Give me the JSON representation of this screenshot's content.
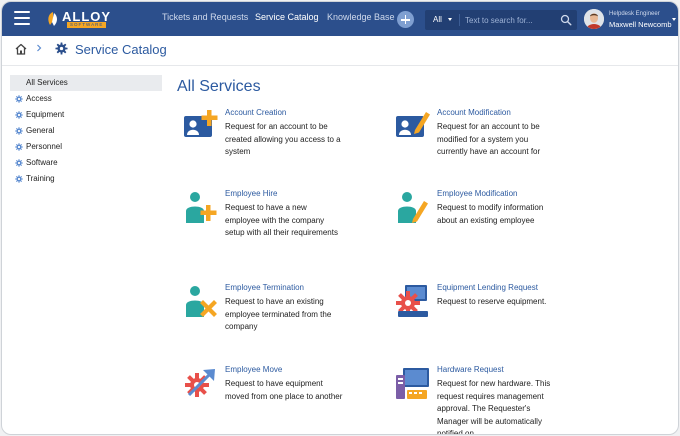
{
  "header": {
    "logo": {
      "brand": "ALLOY",
      "sub": "SOFTWARE"
    },
    "nav": [
      {
        "label": "Tickets and Requests",
        "active": false
      },
      {
        "label": "Service Catalog",
        "active": true
      },
      {
        "label": "Knowledge Base",
        "active": false
      }
    ],
    "add_icon": "plus-icon",
    "search": {
      "scope": "All",
      "placeholder": "Text to search for..."
    },
    "user": {
      "role": "Helpdesk Engineer",
      "name": "Maxwell Newcomb"
    },
    "colors": {
      "bar": "#2c4f8c",
      "search_bg": "#223f73",
      "accent": "#f5a623"
    }
  },
  "breadcrumb": {
    "home_icon": "home-icon",
    "current": "Service Catalog"
  },
  "sidebar": {
    "items": [
      {
        "label": "All Services",
        "active": true
      },
      {
        "label": "Access"
      },
      {
        "label": "Equipment"
      },
      {
        "label": "General"
      },
      {
        "label": "Personnel"
      },
      {
        "label": "Software"
      },
      {
        "label": "Training"
      }
    ]
  },
  "main": {
    "title": "All Services",
    "services": [
      {
        "title": "Account Creation",
        "description": "Request for an account to be created allowing you access to a system",
        "icon": "id-card-plus-icon"
      },
      {
        "title": "Account Modification",
        "description": "Request for an account to be modified for a system you currently have an account for",
        "icon": "id-card-edit-icon"
      },
      {
        "title": "Employee Hire",
        "description": "Request to have a new employee with the company setup with all their requirements",
        "icon": "person-plus-icon"
      },
      {
        "title": "Employee Modification",
        "description": "Request to modify information about an existing employee",
        "icon": "person-edit-icon"
      },
      {
        "title": "Employee Termination",
        "description": "Request to have an existing employee terminated from the company",
        "icon": "person-remove-icon"
      },
      {
        "title": "Equipment Lending Request",
        "description": "Request to reserve equipment.",
        "icon": "equipment-lending-icon"
      },
      {
        "title": "Employee Move",
        "description": "Request to have equipment moved from one place to another",
        "icon": "gear-move-icon"
      },
      {
        "title": "Hardware Request",
        "description": "Request for new hardware. This request requires management approval. The Requester's Manager will be automatically notified on",
        "icon": "computer-hardware-icon"
      }
    ]
  }
}
